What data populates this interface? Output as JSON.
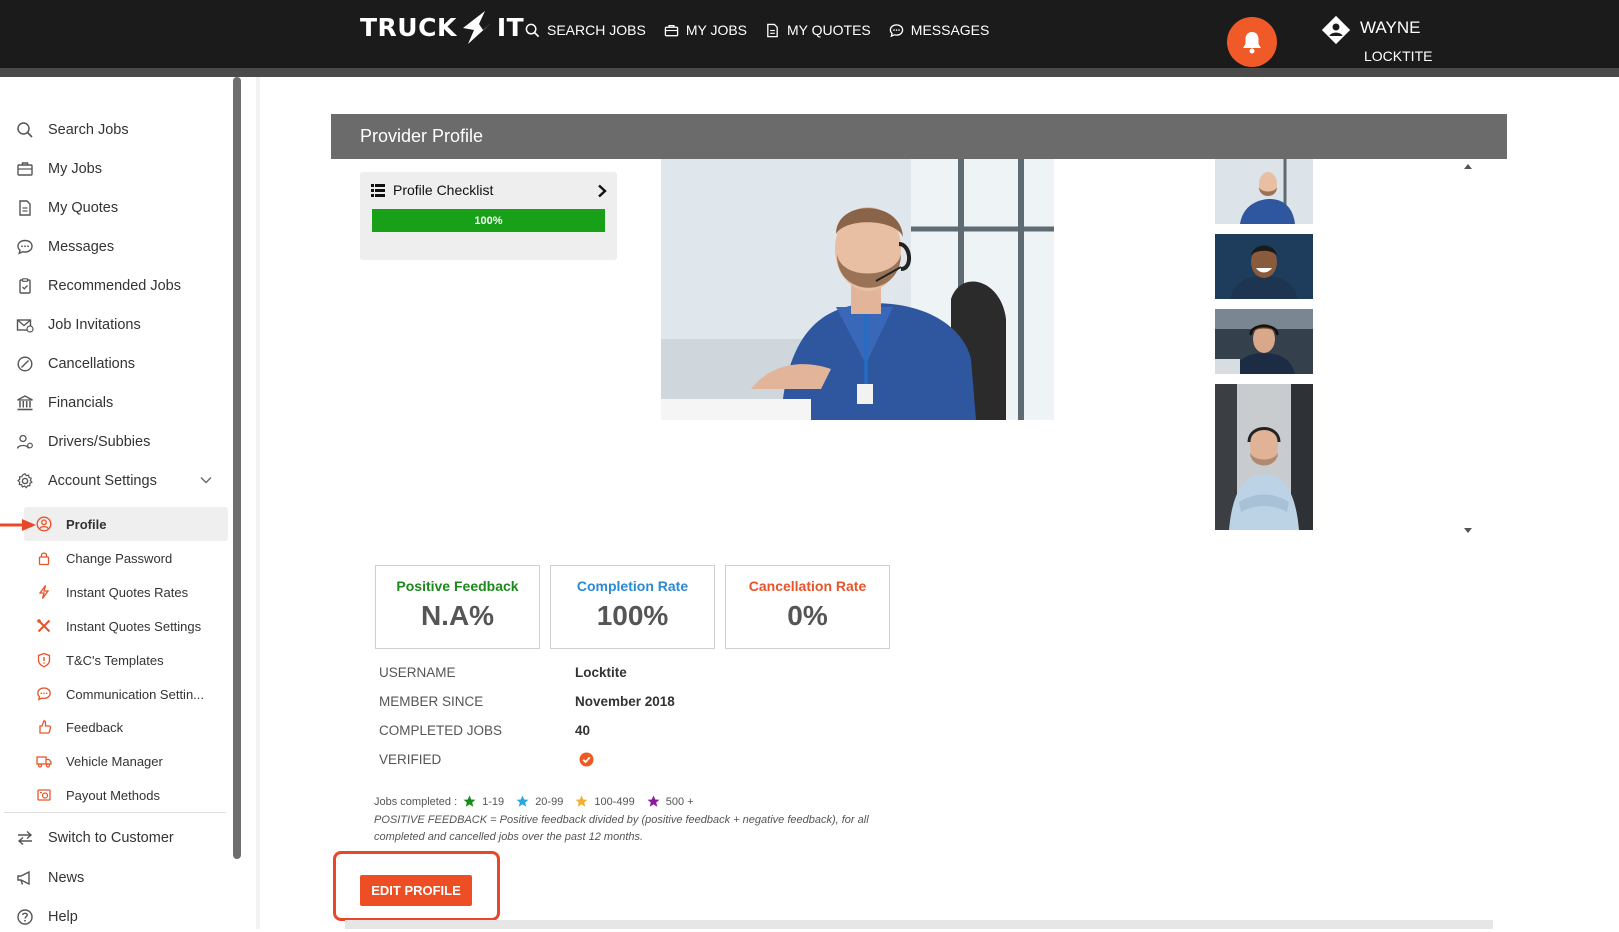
{
  "brand": {
    "logo_left": "TRUCK",
    "logo_right": "IT",
    "accent": "#f05a28"
  },
  "topnav": [
    {
      "label": "SEARCH JOBS",
      "icon": "search-icon"
    },
    {
      "label": "MY JOBS",
      "icon": "briefcase-icon"
    },
    {
      "label": "MY QUOTES",
      "icon": "document-icon"
    },
    {
      "label": "MESSAGES",
      "icon": "chat-icon"
    }
  ],
  "user": {
    "name": "WAYNE",
    "company": "LOCKTITE"
  },
  "sidebar": {
    "items": [
      {
        "label": "Search Jobs",
        "icon": "search-icon"
      },
      {
        "label": "My Jobs",
        "icon": "briefcase-icon"
      },
      {
        "label": "My Quotes",
        "icon": "document-icon"
      },
      {
        "label": "Messages",
        "icon": "chat-icon"
      },
      {
        "label": "Recommended Jobs",
        "icon": "clipboard-icon"
      },
      {
        "label": "Job Invitations",
        "icon": "envelope-icon"
      },
      {
        "label": "Cancellations",
        "icon": "cancel-icon"
      },
      {
        "label": "Financials",
        "icon": "bank-icon"
      },
      {
        "label": "Drivers/Subbies",
        "icon": "people-icon"
      },
      {
        "label": "Account Settings",
        "icon": "gear-icon"
      }
    ],
    "sub_items": [
      {
        "label": "Profile",
        "icon": "user-circle-icon"
      },
      {
        "label": "Change Password",
        "icon": "lock-icon"
      },
      {
        "label": "Instant Quotes Rates",
        "icon": "bolt-icon"
      },
      {
        "label": "Instant Quotes Settings",
        "icon": "tools-icon"
      },
      {
        "label": "T&C's Templates",
        "icon": "shield-icon"
      },
      {
        "label": "Communication Settin...",
        "icon": "chat-icon"
      },
      {
        "label": "Feedback",
        "icon": "thumb-icon"
      },
      {
        "label": "Vehicle Manager",
        "icon": "truck-icon"
      },
      {
        "label": "Payout Methods",
        "icon": "wallet-icon"
      }
    ],
    "bottom_items": [
      {
        "label": "Switch to Customer",
        "icon": "switch-icon"
      },
      {
        "label": "News",
        "icon": "megaphone-icon"
      },
      {
        "label": "Help",
        "icon": "help-icon"
      }
    ]
  },
  "main": {
    "panel_title": "Provider Profile",
    "checklist": {
      "title": "Profile Checklist",
      "progress_label": "100%",
      "progress": 1.0
    },
    "stats": [
      {
        "label": "Positive Feedback",
        "value": "N.A%",
        "color": "#1a8a1a"
      },
      {
        "label": "Completion Rate",
        "value": "100%",
        "color": "#2a8ad2"
      },
      {
        "label": "Cancellation Rate",
        "value": "0%",
        "color": "#e8542a"
      }
    ],
    "info": [
      {
        "key": "USERNAME",
        "value": "Locktite"
      },
      {
        "key": "MEMBER SINCE",
        "value": "November 2018"
      },
      {
        "key": "COMPLETED JOBS",
        "value": "40"
      },
      {
        "key": "VERIFIED",
        "value": ""
      }
    ],
    "legend": {
      "prefix": "Jobs completed :",
      "tiers": [
        {
          "range": "1-19",
          "color": "#1a8a1a"
        },
        {
          "range": "20-99",
          "color": "#2aa8e0"
        },
        {
          "range": "100-499",
          "color": "#f0b030"
        },
        {
          "range": "500 +",
          "color": "#8a1a9a"
        }
      ]
    },
    "note": "POSITIVE FEEDBACK = Positive feedback divided by (positive feedback + negative feedback), for all completed and cancelled jobs over the past 12 months.",
    "edit_button": "EDIT PROFILE"
  }
}
